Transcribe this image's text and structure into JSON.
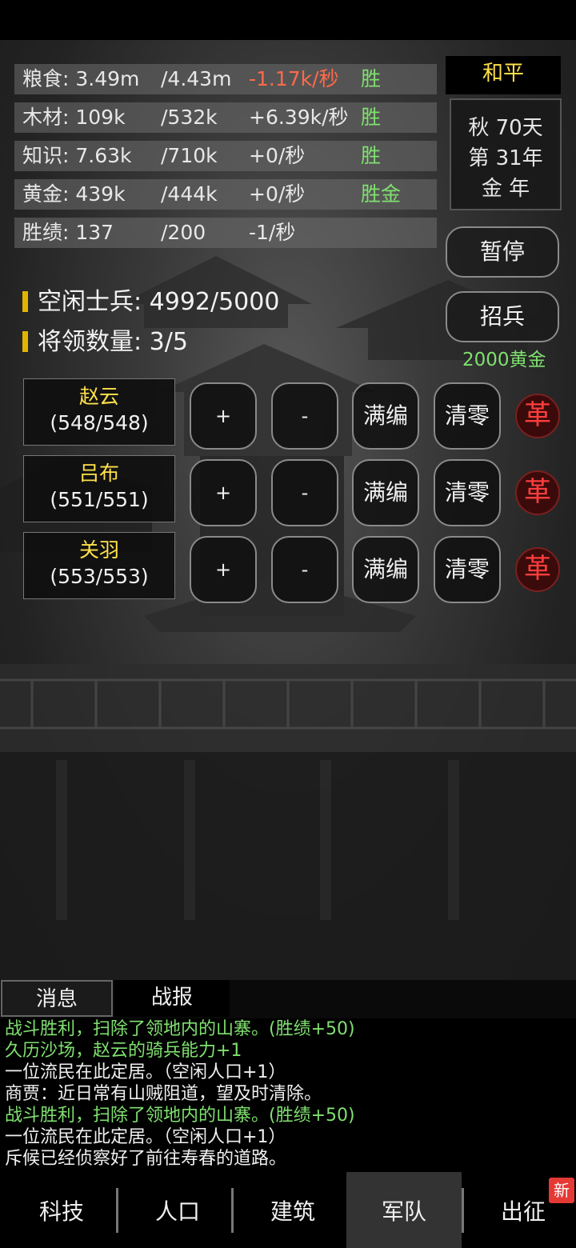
{
  "resources": [
    {
      "name": "粮食: 3.49m",
      "max": "/4.43m",
      "rate": "-1.17k/秒",
      "rate_negative": true,
      "tag": "胜"
    },
    {
      "name": "木材: 109k",
      "max": "/532k",
      "rate": "+6.39k/秒",
      "rate_negative": false,
      "tag": "胜"
    },
    {
      "name": "知识: 7.63k",
      "max": "/710k",
      "rate": "+0/秒",
      "rate_negative": false,
      "tag": "胜"
    },
    {
      "name": "黄金: 439k",
      "max": "/444k",
      "rate": "+0/秒",
      "rate_negative": false,
      "tag": "胜金"
    },
    {
      "name": "胜绩: 137",
      "max": "/200",
      "rate": "-1/秒",
      "rate_negative": false,
      "tag": ""
    }
  ],
  "status": {
    "peace": "和平",
    "season_day": "秋 70天",
    "year": "第 31年",
    "element_year": "金 年"
  },
  "buttons": {
    "pause": "暂停",
    "recruit": "招兵",
    "recruit_cost": "2000黄金"
  },
  "army": {
    "idle_soldiers": "空闲士兵: 4992/5000",
    "general_count": "将领数量: 3/5"
  },
  "generals": [
    {
      "name": "赵云",
      "count": "(548/548)"
    },
    {
      "name": "吕布",
      "count": "(551/551)"
    },
    {
      "name": "关羽",
      "count": "(553/553)"
    }
  ],
  "general_controls": {
    "plus": "+",
    "minus": "-",
    "fill": "满编",
    "clear": "清零",
    "dismiss": "革"
  },
  "tabs": {
    "messages": "消息",
    "battle_report": "战报"
  },
  "log": [
    {
      "text": "战斗胜利，扫除了领地内的山寨。(胜绩+50)",
      "win": true
    },
    {
      "text": "久历沙场，赵云的骑兵能力+1",
      "win": true
    },
    {
      "text": "一位流民在此定居。（空闲人口+1）",
      "win": false
    },
    {
      "text": "商贾：近日常有山贼阻道，望及时清除。",
      "win": false
    },
    {
      "text": "战斗胜利，扫除了领地内的山寨。(胜绩+50)",
      "win": true
    },
    {
      "text": "一位流民在此定居。（空闲人口+1）",
      "win": false
    },
    {
      "text": "斥候已经侦察好了前往寿春的道路。",
      "win": false
    }
  ],
  "nav": {
    "tech": "科技",
    "population": "人口",
    "buildings": "建筑",
    "army": "军队",
    "expedition": "出征",
    "new_badge": "新",
    "active": "army"
  },
  "colors": {
    "positive_green": "#7fe06f",
    "negative_red": "#ff6a4a",
    "gold_yellow": "#ffe14a",
    "dismiss_red": "#ff3d3d"
  }
}
